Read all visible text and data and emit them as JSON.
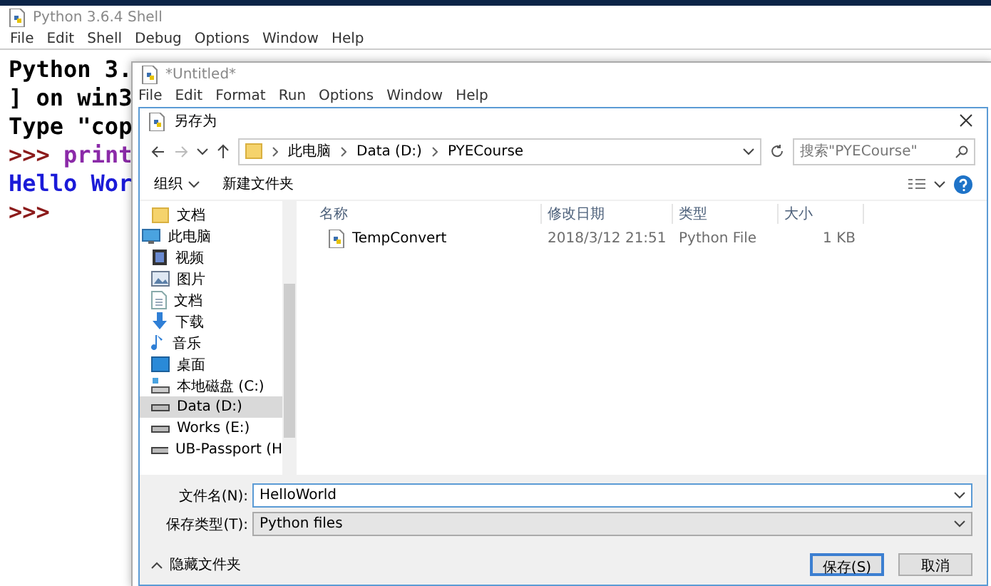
{
  "shell": {
    "title": "Python 3.6.4 Shell",
    "menu": [
      "File",
      "Edit",
      "Shell",
      "Debug",
      "Options",
      "Window",
      "Help"
    ],
    "lines": [
      {
        "kind": "output",
        "text": "Python 3."
      },
      {
        "kind": "output",
        "text": "] on win3"
      },
      {
        "kind": "output",
        "text": "Type \"cop"
      },
      {
        "kind": "prompt",
        "prompt": ">>>",
        "code": "print"
      },
      {
        "kind": "result",
        "text": "Hello Wor"
      },
      {
        "kind": "prompt",
        "prompt": ">>>"
      }
    ]
  },
  "editor": {
    "title": "*Untitled*",
    "menu": [
      "File",
      "Edit",
      "Format",
      "Run",
      "Options",
      "Window",
      "Help"
    ]
  },
  "dialog": {
    "title": "另存为",
    "breadcrumb": [
      "此电脑",
      "Data (D:)",
      "PYECourse"
    ],
    "search": {
      "placeholder": "搜索\"PYECourse\""
    },
    "toolbar": {
      "organize": "组织",
      "new_folder": "新建文件夹"
    },
    "sidebar": [
      {
        "kind": "folder",
        "label": "文档",
        "selected": false
      },
      {
        "kind": "pc",
        "label": "此电脑",
        "selected": false
      },
      {
        "kind": "video",
        "label": "视频",
        "selected": false
      },
      {
        "kind": "pictures",
        "label": "图片",
        "selected": false
      },
      {
        "kind": "docs",
        "label": "文档",
        "selected": false
      },
      {
        "kind": "download",
        "label": "下载",
        "selected": false
      },
      {
        "kind": "music",
        "label": "音乐",
        "selected": false
      },
      {
        "kind": "desktop",
        "label": "桌面",
        "selected": false
      },
      {
        "kind": "system-drive",
        "label": "本地磁盘 (C:)",
        "selected": false
      },
      {
        "kind": "drive",
        "label": "Data (D:)",
        "selected": true
      },
      {
        "kind": "drive",
        "label": "Works (E:)",
        "selected": false
      },
      {
        "kind": "drive",
        "label": "UB-Passport (H",
        "selected": false
      }
    ],
    "columns": [
      "名称",
      "修改日期",
      "类型",
      "大小"
    ],
    "rows": [
      {
        "name": "TempConvert",
        "date": "2018/3/12 21:51",
        "type": "Python File",
        "size": "1 KB"
      }
    ],
    "filename": {
      "label": "文件名(N):",
      "value": "HelloWorld"
    },
    "filetype": {
      "label": "保存类型(T):",
      "value": "Python files"
    },
    "hide_folders": "隐藏文件夹",
    "save": "保存(S)",
    "cancel": "取消"
  }
}
